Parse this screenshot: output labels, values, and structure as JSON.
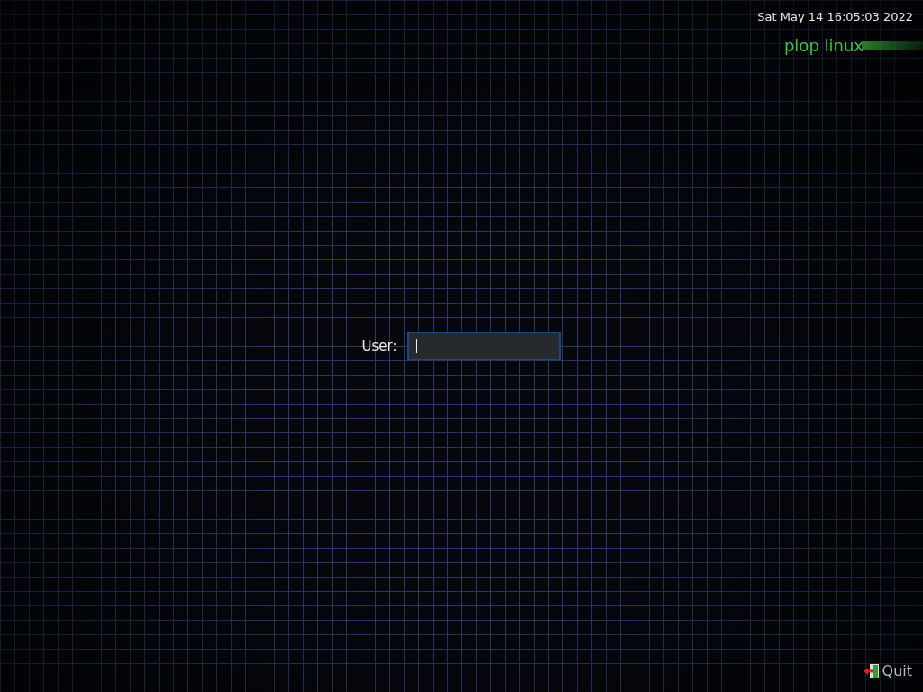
{
  "clock": "Sat May 14 16:05:03 2022",
  "logo": "plop linux",
  "login": {
    "label": "User:"
  },
  "quit_button": {
    "label": "Quit"
  }
}
